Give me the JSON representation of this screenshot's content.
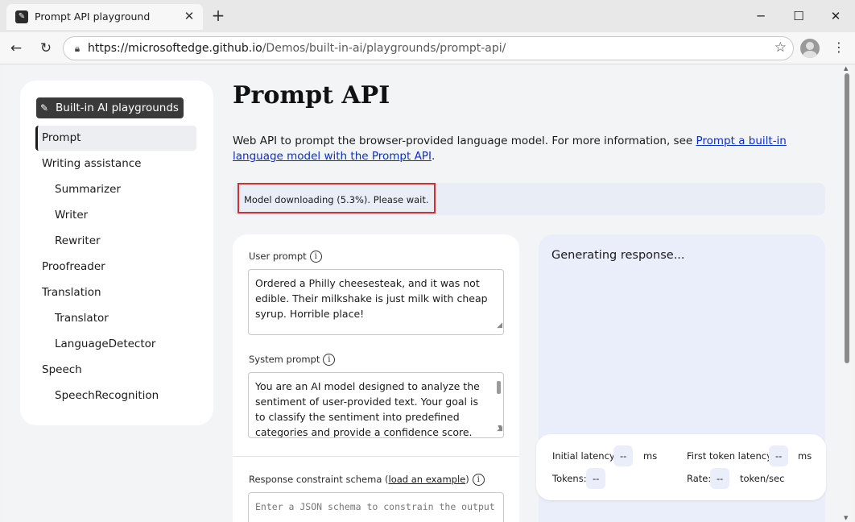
{
  "browser": {
    "tab_title": "Prompt API playground",
    "url_host": "https://microsoftedge.github.io",
    "url_path": "/Demos/built-in-ai/playgrounds/prompt-api/"
  },
  "sidebar": {
    "brand": "Built-in AI playgrounds",
    "items": [
      {
        "label": "Prompt"
      },
      {
        "label": "Writing assistance"
      },
      {
        "label": "Summarizer"
      },
      {
        "label": "Writer"
      },
      {
        "label": "Rewriter"
      },
      {
        "label": "Proofreader"
      },
      {
        "label": "Translation"
      },
      {
        "label": "Translator"
      },
      {
        "label": "LanguageDetector"
      },
      {
        "label": "Speech"
      },
      {
        "label": "SpeechRecognition"
      }
    ]
  },
  "main": {
    "title": "Prompt API",
    "desc_text": "Web API to prompt the browser-provided language model. For more information, see ",
    "desc_link": "Prompt a built-in language model with the Prompt API",
    "desc_end": ".",
    "status": "Model downloading (5.3%). Please wait."
  },
  "form": {
    "user_prompt_label": "User prompt",
    "user_prompt_value": "Ordered a Philly cheesesteak, and it was not edible. Their milkshake is just milk with cheap syrup. Horrible place!",
    "system_prompt_label": "System prompt",
    "system_prompt_value": "You are an AI model designed to analyze the sentiment of user-provided text. Your goal is to classify the sentiment into predefined categories and provide a confidence score.",
    "schema_label": "Response constraint schema (",
    "schema_link": "load an example",
    "schema_label_end": ")",
    "schema_placeholder": "Enter a JSON schema to constrain the output"
  },
  "response": {
    "text": "Generating response...",
    "initial_latency_label": "Initial latency:",
    "initial_latency_value": "--",
    "initial_latency_unit": "ms",
    "first_token_label": "First token latency:",
    "first_token_value": "--",
    "first_token_unit": "ms",
    "tokens_label": "Tokens:",
    "tokens_value": "--",
    "rate_label": "Rate:",
    "rate_value": "--",
    "rate_unit": "token/sec"
  }
}
